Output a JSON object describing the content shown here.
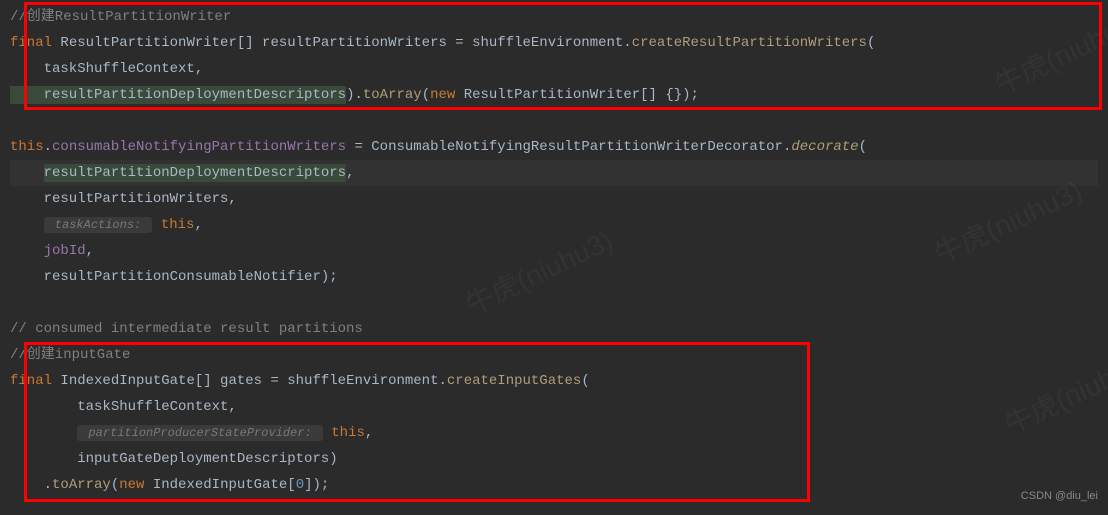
{
  "lines": {
    "l1_comment": "//创建ResultPartitionWriter",
    "l2_final": "final",
    "l2_type": " ResultPartitionWriter[] resultPartitionWriters = shuffleEnvironment.",
    "l2_method": "createResultPartitionWriters",
    "l2_end": "(",
    "l3": "    taskShuffleContext,",
    "l4_arg": "    resultPartitionDeploymentDescriptors",
    "l4_paren": ").",
    "l4_method": "toArray",
    "l4_open": "(",
    "l4_new": "new",
    "l4_type2": " ResultPartitionWriter[] {});",
    "l6_this": "this",
    "l6_dot": ".",
    "l6_field": "consumableNotifyingPartitionWriters",
    "l6_eq": " = ConsumableNotifyingResultPartitionWriterDecorator.",
    "l6_method": "decorate",
    "l6_end": "(",
    "l7_pre": "    ",
    "l7_arg_a": "resultPartitionDeploymentDesc",
    "l7_arg_b": "riptors",
    "l7_comma": ",",
    "l8": "    resultPartitionWriters,",
    "l9_pre": "    ",
    "l9_hint": " taskActions: ",
    "l9_this": "this",
    "l9_comma": ",",
    "l10_pre": "    ",
    "l10_field": "jobId",
    "l10_comma": ",",
    "l11": "    resultPartitionConsumableNotifier);",
    "l13_comment": "// consumed intermediate result partitions",
    "l14_comment": "//创建inputGate",
    "l15_final": "final",
    "l15_type": " IndexedInputGate[] gates = shuffleEnvironment.",
    "l15_method": "createInputGates",
    "l15_end": "(",
    "l16": "        taskShuffleContext,",
    "l17_pre": "        ",
    "l17_hint": " partitionProducerStateProvider: ",
    "l17_this": "this",
    "l17_comma": ",",
    "l18": "        inputGateDeploymentDescriptors)",
    "l19_pre": "    .",
    "l19_method": "toArray",
    "l19_open": "(",
    "l19_new": "new",
    "l19_type": " IndexedInputGate[",
    "l19_num": "0",
    "l19_end": "]);"
  },
  "watermark": "牛虎(niuhu3)",
  "attribution": "CSDN @diu_lei"
}
